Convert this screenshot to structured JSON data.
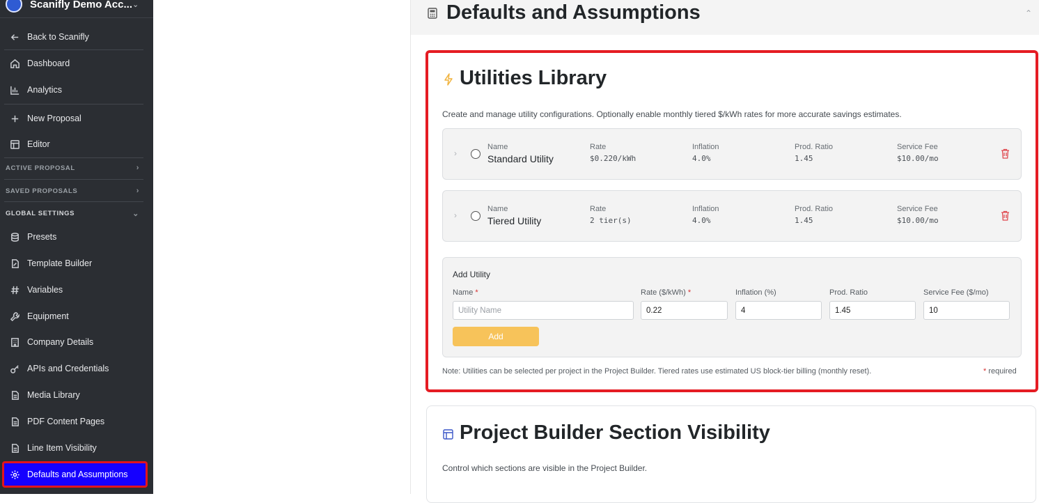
{
  "sidebar": {
    "company": "Scanifly Demo Acc...",
    "items": {
      "back": "Back to Scanifly",
      "dashboard": "Dashboard",
      "analytics": "Analytics",
      "new_proposal": "New Proposal",
      "editor": "Editor"
    },
    "sections": {
      "active": "ACTIVE PROPOSAL",
      "saved": "SAVED PROPOSALS",
      "global": "GLOBAL SETTINGS"
    },
    "global_items": [
      "Presets",
      "Template Builder",
      "Variables",
      "Equipment",
      "Company Details",
      "APIs and Credentials",
      "Media Library",
      "PDF Content Pages",
      "Line Item Visibility",
      "Defaults and Assumptions"
    ]
  },
  "page": {
    "title": "Defaults and Assumptions"
  },
  "utilities": {
    "title": "Utilities Library",
    "description": "Create and manage utility configurations. Optionally enable monthly tiered $/kWh rates for more accurate savings estimates.",
    "columns": {
      "name": "Name",
      "rate": "Rate",
      "inflation": "Inflation",
      "ratio": "Prod. Ratio",
      "fee": "Service Fee"
    },
    "rows": [
      {
        "name": "Standard Utility",
        "rate": "$0.220/kWh",
        "inflation": "4.0%",
        "ratio": "1.45",
        "fee": "$10.00/mo"
      },
      {
        "name": "Tiered Utility",
        "rate": "2 tier(s)",
        "inflation": "4.0%",
        "ratio": "1.45",
        "fee": "$10.00/mo"
      }
    ],
    "add": {
      "title": "Add Utility",
      "name_label": "Name",
      "rate_label": "Rate ($/kWh)",
      "inflation_label": "Inflation (%)",
      "ratio_label": "Prod. Ratio",
      "fee_label": "Service Fee ($/mo)",
      "required_mark": "*",
      "name_placeholder": "Utility Name",
      "rate_value": "0.22",
      "inflation_value": "4",
      "ratio_value": "1.45",
      "fee_value": "10",
      "button": "Add"
    },
    "note": "Note: Utilities can be selected per project in the Project Builder. Tiered rates use estimated US block-tier billing (monthly reset).",
    "required_note": "* required"
  },
  "visibility": {
    "title": "Project Builder Section Visibility",
    "description": "Control which sections are visible in the Project Builder."
  },
  "colors": {
    "accent": "#f7c35a",
    "highlight": "#e51c23",
    "selected": "#1500ff",
    "sidebar_bg": "#2b2e33"
  }
}
